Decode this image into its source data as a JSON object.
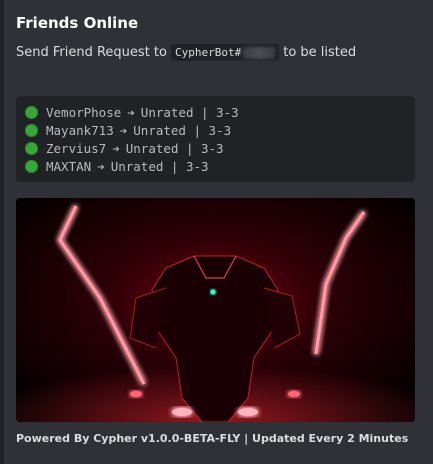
{
  "embed": {
    "title": "Friends Online",
    "description": {
      "prefix": "Send Friend Request to",
      "bot_name": "CypherBot#",
      "suffix": "to be listed"
    },
    "friends": [
      {
        "name": "VemorPhose",
        "arrow": "➔",
        "status": "Unrated | 3-3"
      },
      {
        "name": "Mayank713",
        "arrow": "➔",
        "status": "Unrated | 3-3"
      },
      {
        "name": "Zervius7",
        "arrow": "➔",
        "status": "Unrated | 3-3"
      },
      {
        "name": "MAXTAN",
        "arrow": "➔",
        "status": "Unrated | 3-3"
      }
    ],
    "footer": "Powered By Cypher v1.0.0-BETA-FLY | Updated Every 2 Minutes"
  },
  "colors": {
    "background": "#2f3136",
    "code_background": "#202225",
    "online": "#3ba53b",
    "neon": "#ff3344"
  }
}
